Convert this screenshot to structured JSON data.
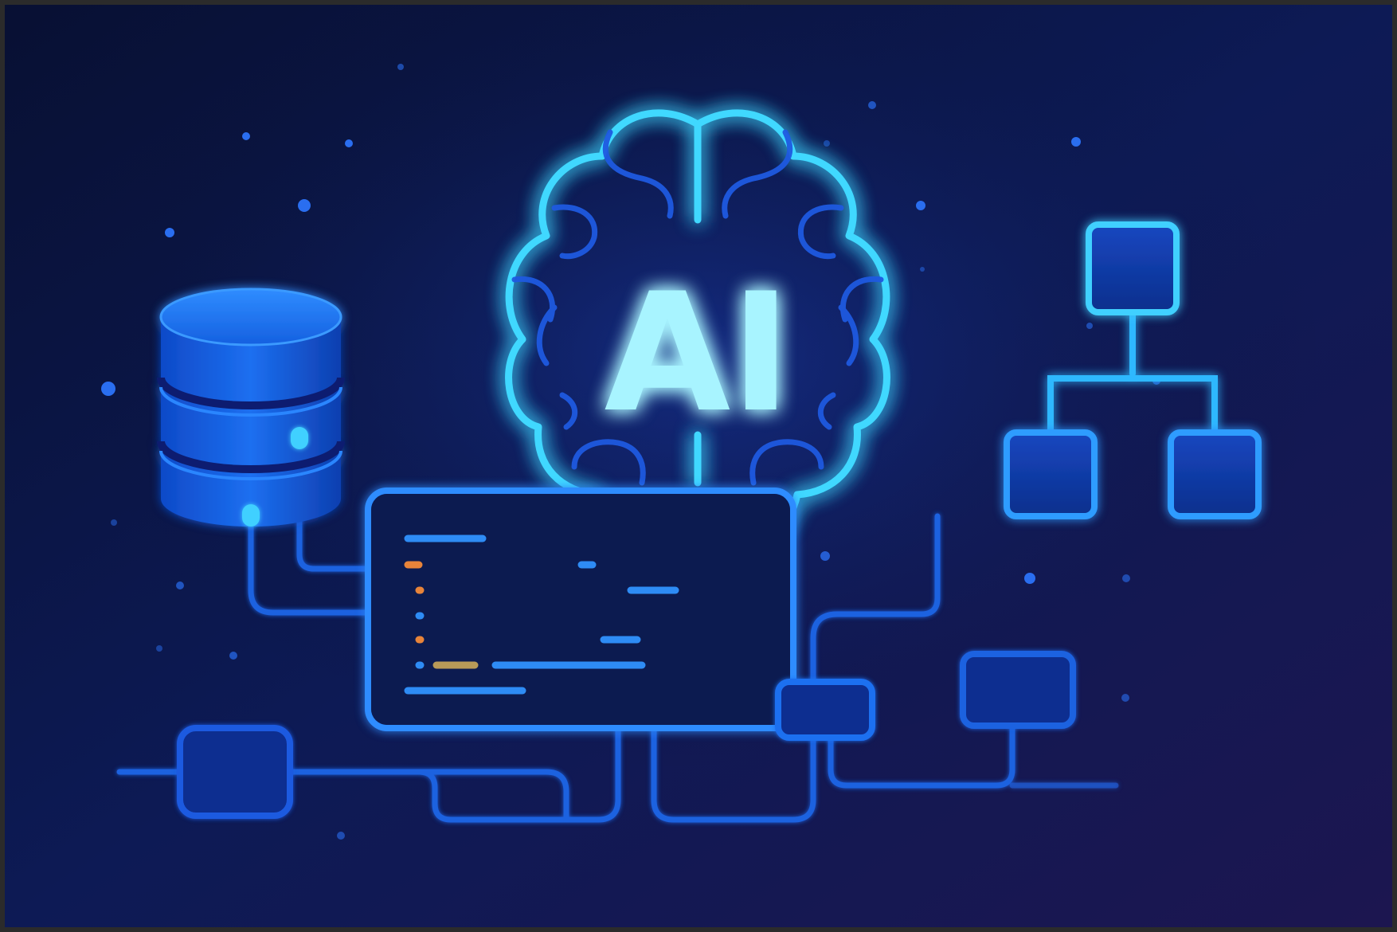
{
  "illustration": {
    "headline": "AI",
    "colors": {
      "background_start": "#0a1235",
      "background_end": "#1a1648",
      "glow_cyan": "#3fd8ff",
      "line_blue": "#1f6ff0",
      "box_fill": "#0f3aa8",
      "text_glow": "#a8f4ff",
      "code_orange": "#e8843a",
      "code_yellow": "#d8c86a",
      "code_blue": "#2e8cf5"
    },
    "icons": [
      "database-icon",
      "brain-icon",
      "code-window-icon",
      "hierarchy-diagram-icon",
      "circuit-lines-icon"
    ]
  }
}
